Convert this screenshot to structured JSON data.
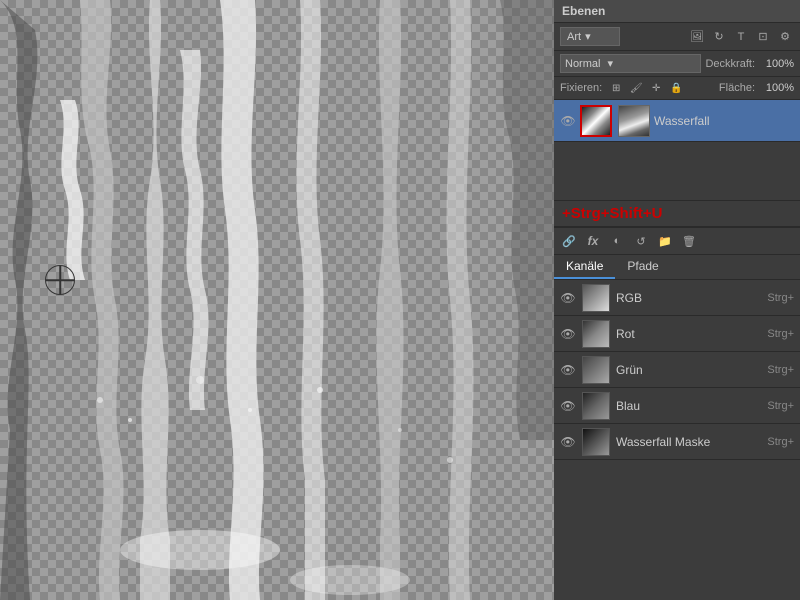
{
  "panel": {
    "title": "Ebenen",
    "artLabel": "Art",
    "blendMode": "Normal",
    "opacityLabel": "Deckkraft:",
    "opacityValue": "100%",
    "fixierenLabel": "Fixieren:",
    "flacheLabel": "Fläche:",
    "flacheValue": "100%",
    "shortcutText": "+Strg+Shift+U"
  },
  "layers": [
    {
      "name": "Wasserfall",
      "visible": true,
      "selected": true,
      "hasMask": true
    }
  ],
  "bottomIcons": [
    "link",
    "fx",
    "adjustment",
    "cycle",
    "folder",
    "trash"
  ],
  "tabs": [
    {
      "label": "Kanäle",
      "active": true
    },
    {
      "label": "Pfade",
      "active": false
    }
  ],
  "channels": [
    {
      "name": "RGB",
      "shortcut": "Strg+",
      "type": "rgb"
    },
    {
      "name": "Rot",
      "shortcut": "Strg+",
      "type": "red"
    },
    {
      "name": "Grün",
      "shortcut": "Strg+",
      "type": "green"
    },
    {
      "name": "Blau",
      "shortcut": "Strg+",
      "type": "blue"
    },
    {
      "name": "Wasserfall Maske",
      "shortcut": "Strg+",
      "type": "mask"
    }
  ]
}
